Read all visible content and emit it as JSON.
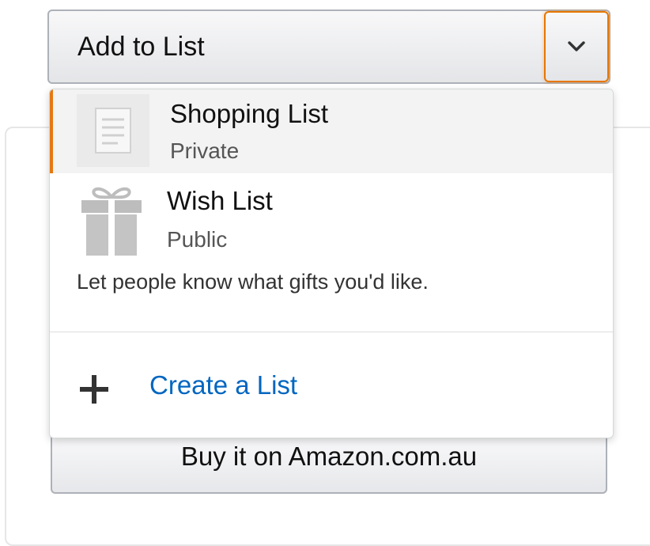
{
  "add_to_list_button": {
    "label": "Add to List",
    "dropdown_icon": "chevron-down-icon"
  },
  "dropdown": {
    "options": [
      {
        "title": "Shopping List",
        "visibility": "Private",
        "icon": "list-icon",
        "selected": true
      },
      {
        "title": "Wish List",
        "visibility": "Public",
        "description": "Let people know what gifts you'd like.",
        "icon": "gift-icon",
        "selected": false
      }
    ],
    "create_list": {
      "label": "Create a List",
      "icon": "plus-icon"
    }
  },
  "buy_button": {
    "label": "Buy it on Amazon.com.au"
  },
  "colors": {
    "accent_orange": "#e47911",
    "link_blue": "#0066c0"
  }
}
